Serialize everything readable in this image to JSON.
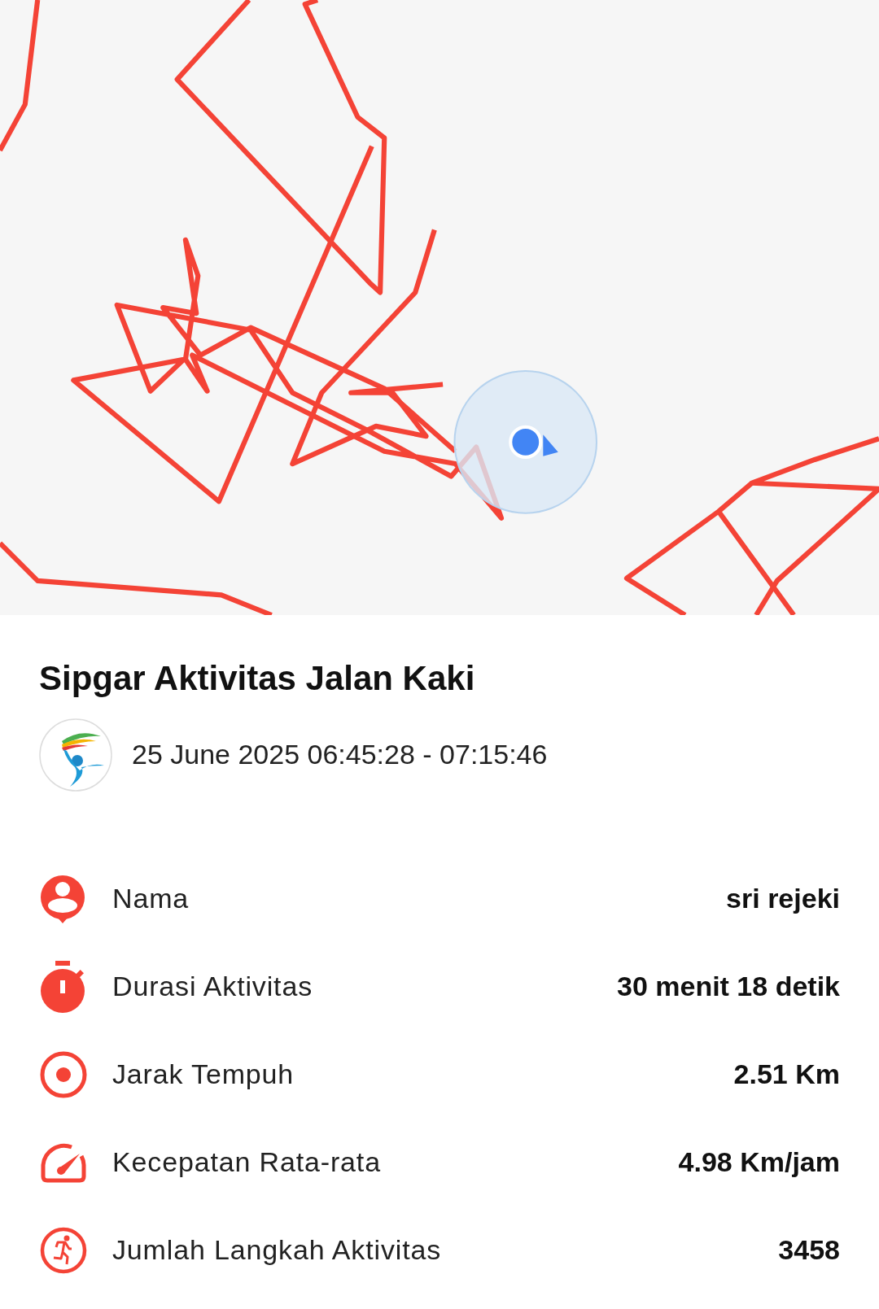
{
  "title": "Sipgar Aktivitas Jalan Kaki",
  "date": "25 June 2025 06:45:28 - 07:15:46",
  "stats": [
    {
      "kind": "person",
      "label": "Nama",
      "value": "sri rejeki"
    },
    {
      "kind": "timer",
      "label": "Durasi Aktivitas",
      "value": "30 menit 18 detik"
    },
    {
      "kind": "target",
      "label": "Jarak Tempuh",
      "value": "2.51 Km"
    },
    {
      "kind": "speed",
      "label": "Kecepatan Rata-rata",
      "value": "4.98 Km/jam"
    },
    {
      "kind": "steps",
      "label": "Jumlah Langkah Aktivitas",
      "value": "3458"
    }
  ]
}
